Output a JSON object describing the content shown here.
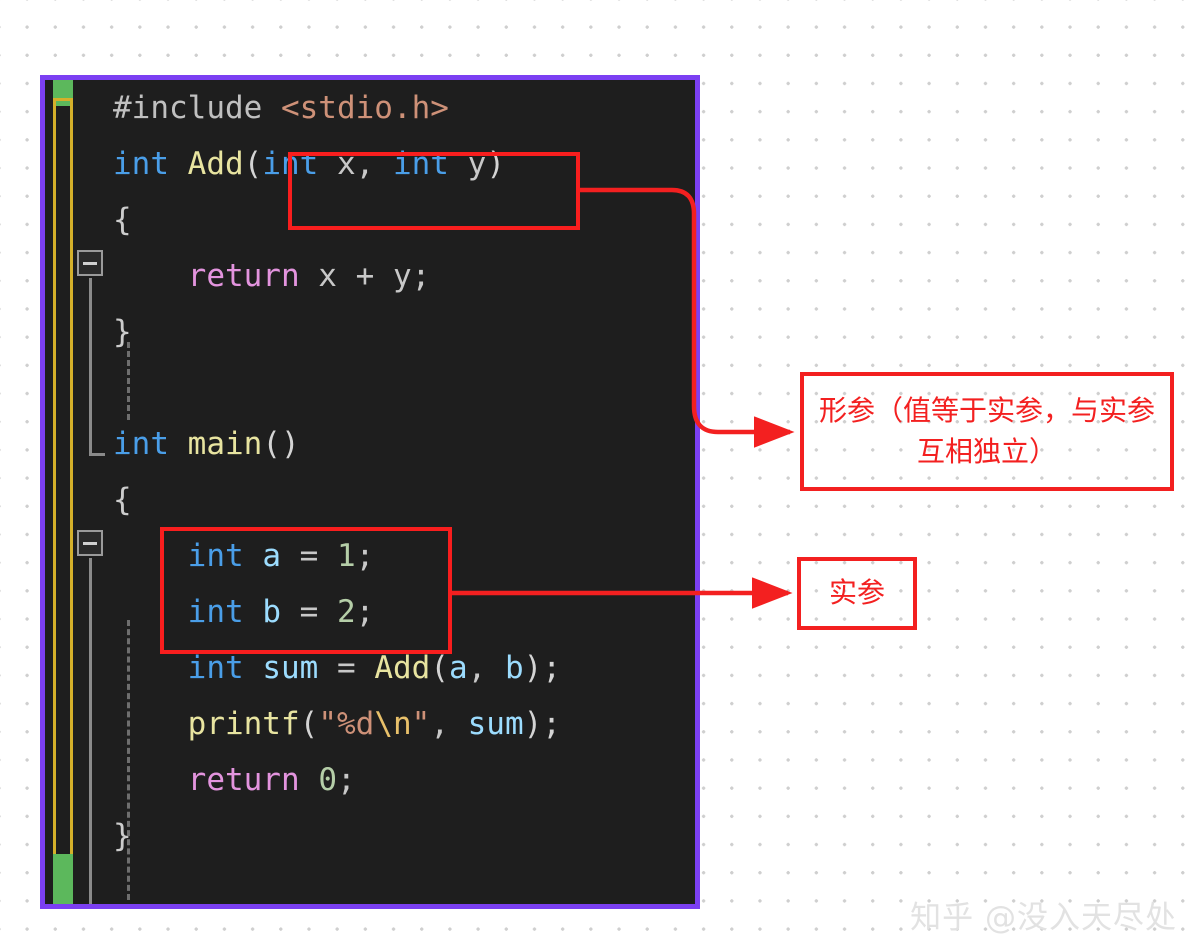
{
  "editor": {
    "background_color": "#1e1e1e",
    "border_color": "#7b3ff2",
    "gutter": {
      "changed_marker_color": "#5cb85c",
      "modified_marker_color": "#d4b02a"
    },
    "code_lines": [
      {
        "id": "line-include",
        "tokens": [
          {
            "text": "#include ",
            "kind": "preprocessor"
          },
          {
            "text": "<stdio.h>",
            "kind": "header"
          }
        ]
      },
      {
        "id": "line-add-signature",
        "fold": true,
        "tokens": [
          {
            "text": "int ",
            "kind": "keyword"
          },
          {
            "text": "Add",
            "kind": "function"
          },
          {
            "text": "(",
            "kind": "punct"
          },
          {
            "text": "int ",
            "kind": "keyword"
          },
          {
            "text": "x",
            "kind": "plain"
          },
          {
            "text": ", ",
            "kind": "plain"
          },
          {
            "text": "int ",
            "kind": "keyword"
          },
          {
            "text": "y",
            "kind": "plain"
          },
          {
            "text": ")",
            "kind": "punct"
          }
        ]
      },
      {
        "id": "line-add-open-brace",
        "tokens": [
          {
            "text": "{",
            "kind": "brace"
          }
        ]
      },
      {
        "id": "line-add-return",
        "tokens": [
          {
            "text": "    ",
            "kind": "plain"
          },
          {
            "text": "return",
            "kind": "return"
          },
          {
            "text": " x + y;",
            "kind": "plain"
          }
        ]
      },
      {
        "id": "line-add-close-brace",
        "tokens": [
          {
            "text": "}",
            "kind": "brace"
          }
        ]
      },
      {
        "id": "line-blank",
        "tokens": [
          {
            "text": " ",
            "kind": "plain"
          }
        ]
      },
      {
        "id": "line-main-signature",
        "fold": true,
        "tokens": [
          {
            "text": "int ",
            "kind": "keyword"
          },
          {
            "text": "main",
            "kind": "function"
          },
          {
            "text": "()",
            "kind": "punct"
          }
        ]
      },
      {
        "id": "line-main-open-brace",
        "tokens": [
          {
            "text": "{",
            "kind": "brace"
          }
        ]
      },
      {
        "id": "line-decl-a",
        "tokens": [
          {
            "text": "    ",
            "kind": "plain"
          },
          {
            "text": "int ",
            "kind": "keyword"
          },
          {
            "text": "a",
            "kind": "variable"
          },
          {
            "text": " = ",
            "kind": "plain"
          },
          {
            "text": "1",
            "kind": "number"
          },
          {
            "text": ";",
            "kind": "plain"
          }
        ]
      },
      {
        "id": "line-decl-b",
        "tokens": [
          {
            "text": "    ",
            "kind": "plain"
          },
          {
            "text": "int ",
            "kind": "keyword"
          },
          {
            "text": "b",
            "kind": "variable"
          },
          {
            "text": " = ",
            "kind": "plain"
          },
          {
            "text": "2",
            "kind": "number"
          },
          {
            "text": ";",
            "kind": "plain"
          }
        ]
      },
      {
        "id": "line-decl-sum",
        "tokens": [
          {
            "text": "    ",
            "kind": "plain"
          },
          {
            "text": "int ",
            "kind": "keyword"
          },
          {
            "text": "sum",
            "kind": "variable"
          },
          {
            "text": " = ",
            "kind": "plain"
          },
          {
            "text": "Add",
            "kind": "function"
          },
          {
            "text": "(",
            "kind": "punct"
          },
          {
            "text": "a",
            "kind": "variable"
          },
          {
            "text": ", ",
            "kind": "plain"
          },
          {
            "text": "b",
            "kind": "variable"
          },
          {
            "text": ");",
            "kind": "punct"
          }
        ]
      },
      {
        "id": "line-printf",
        "tokens": [
          {
            "text": "    ",
            "kind": "plain"
          },
          {
            "text": "printf",
            "kind": "function"
          },
          {
            "text": "(",
            "kind": "punct"
          },
          {
            "text": "\"",
            "kind": "string"
          },
          {
            "text": "%d",
            "kind": "string"
          },
          {
            "text": "\\n",
            "kind": "escape"
          },
          {
            "text": "\"",
            "kind": "string"
          },
          {
            "text": ", ",
            "kind": "plain"
          },
          {
            "text": "sum",
            "kind": "variable"
          },
          {
            "text": ");",
            "kind": "punct"
          }
        ]
      },
      {
        "id": "line-main-return",
        "tokens": [
          {
            "text": "    ",
            "kind": "plain"
          },
          {
            "text": "return",
            "kind": "return"
          },
          {
            "text": " ",
            "kind": "plain"
          },
          {
            "text": "0",
            "kind": "number"
          },
          {
            "text": ";",
            "kind": "plain"
          }
        ]
      },
      {
        "id": "line-main-close-brace",
        "tokens": [
          {
            "text": "}",
            "kind": "brace"
          }
        ]
      }
    ]
  },
  "annotations": {
    "highlight_color": "#f81e1e",
    "formal_param_box": {
      "label": "形参（值等于实参，与实参互相独立）",
      "target": "int x, int y"
    },
    "actual_param_box": {
      "label": "实参",
      "target": "int a = 1; int b = 2;"
    }
  },
  "watermark": {
    "text": "知乎 @没入天尽处"
  }
}
